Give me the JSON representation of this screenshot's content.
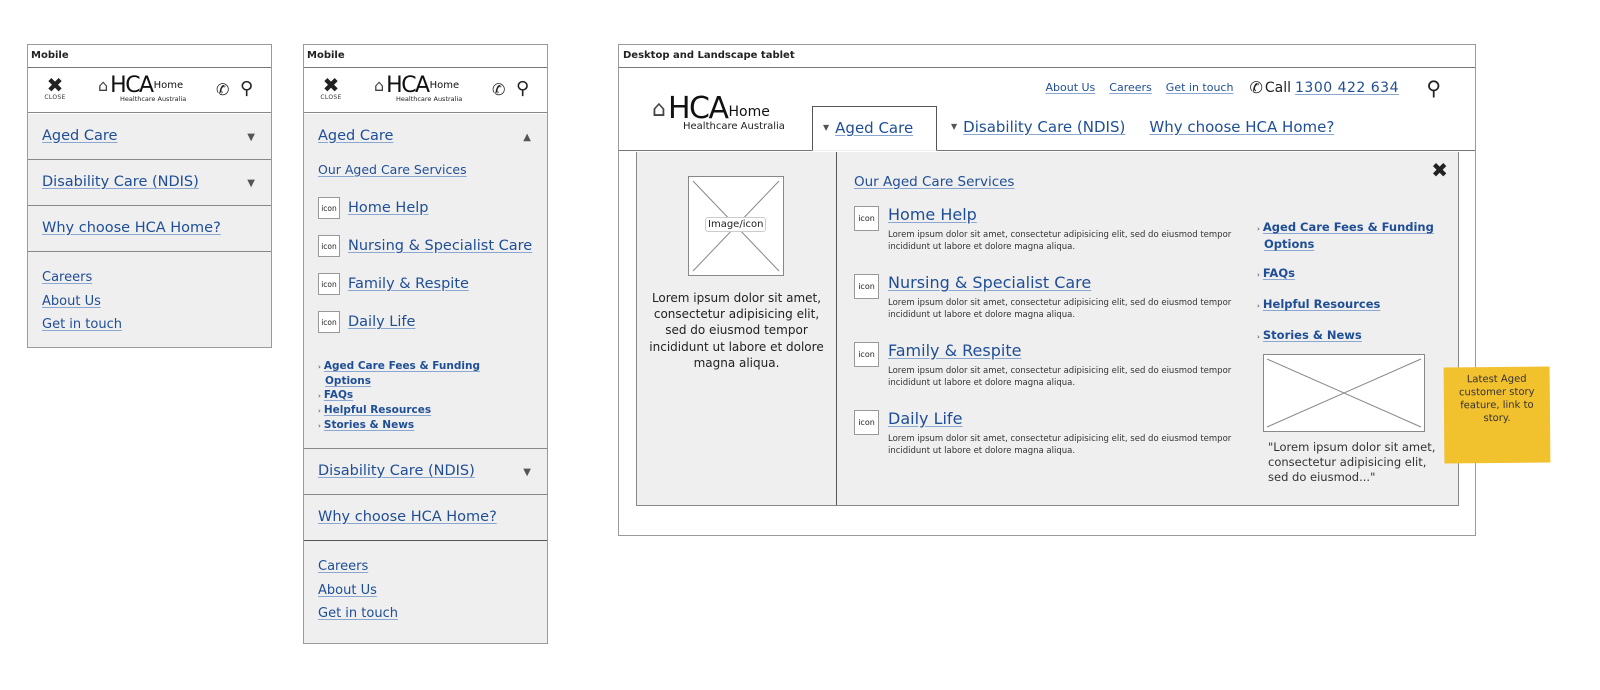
{
  "mobile_collapsed": {
    "frame_label": "Mobile",
    "close_label": "CLOSE",
    "logo": {
      "main": "HCA",
      "home": "Home",
      "sub": "Healthcare Australia"
    },
    "nav": [
      {
        "label": "Aged Care",
        "caret": "▼"
      },
      {
        "label": "Disability Care (NDIS)",
        "caret": "▼"
      },
      {
        "label": "Why choose HCA Home?"
      }
    ],
    "secondary": [
      "Careers",
      "About Us",
      "Get in touch"
    ]
  },
  "mobile_expanded": {
    "frame_label": "Mobile",
    "close_label": "CLOSE",
    "logo": {
      "main": "HCA",
      "home": "Home",
      "sub": "Healthcare Australia"
    },
    "aged_care": {
      "label": "Aged Care",
      "caret": "▲"
    },
    "services_heading": "Our Aged Care Services",
    "icon_label": "icon",
    "services": [
      "Home Help",
      "Nursing & Specialist Care",
      "Family & Respite",
      "Daily Life"
    ],
    "sublinks": [
      "Aged Care Fees & Funding",
      "Options",
      "FAQs",
      "Helpful Resources",
      "Stories & News"
    ],
    "nav": [
      {
        "label": "Disability Care (NDIS)",
        "caret": "▼"
      },
      {
        "label": "Why choose HCA Home?"
      }
    ],
    "secondary": [
      "Careers",
      "About Us",
      "Get in touch"
    ]
  },
  "desktop": {
    "frame_label": "Desktop and Landscape tablet",
    "logo": {
      "main": "HCA",
      "home": "Home",
      "sub": "Healthcare Australia"
    },
    "utility_links": [
      "About Us",
      "Careers",
      "Get in touch"
    ],
    "call_label": "Call",
    "phone_number": "1300 422 634",
    "nav_tabs": [
      {
        "label": "Aged Care",
        "caret": "▼",
        "active": true
      },
      {
        "label": "Disability Care (NDIS)",
        "caret": "▼"
      },
      {
        "label": "Why choose HCA Home?"
      }
    ],
    "mega": {
      "image_label": "Image/icon",
      "intro_text": "Lorem ipsum dolor sit amet, consectetur adipisicing elit, sed do eiusmod tempor incididunt ut labore et dolore magna aliqua.",
      "services_heading": "Our Aged Care Services",
      "icon_label": "icon",
      "services": [
        {
          "title": "Home Help",
          "desc": "Lorem ipsum dolor sit amet, consectetur adipisicing elit, sed do eiusmod tempor incididunt ut labore et dolore magna aliqua."
        },
        {
          "title": "Nursing & Specialist Care",
          "desc": "Lorem ipsum dolor sit amet, consectetur adipisicing elit, sed do eiusmod tempor incididunt ut labore et dolore magna aliqua."
        },
        {
          "title": "Family & Respite",
          "desc": "Lorem ipsum dolor sit amet, consectetur adipisicing elit, sed do eiusmod tempor incididunt ut labore et dolore magna aliqua."
        },
        {
          "title": "Daily Life",
          "desc": "Lorem ipsum dolor sit amet, consectetur adipisicing elit, sed do eiusmod tempor incididunt ut labore et dolore magna aliqua."
        }
      ],
      "side_links": [
        "Aged Care Fees & Funding",
        "Options",
        "FAQs",
        "Helpful Resources",
        "Stories & News"
      ],
      "story_quote": "\"Lorem ipsum dolor sit amet, consectetur adipisicing elit, sed do eiusmod...\""
    },
    "sticky_note": "Latest Aged customer story feature, link to story.",
    "sticky_color": "#f2c12e"
  }
}
